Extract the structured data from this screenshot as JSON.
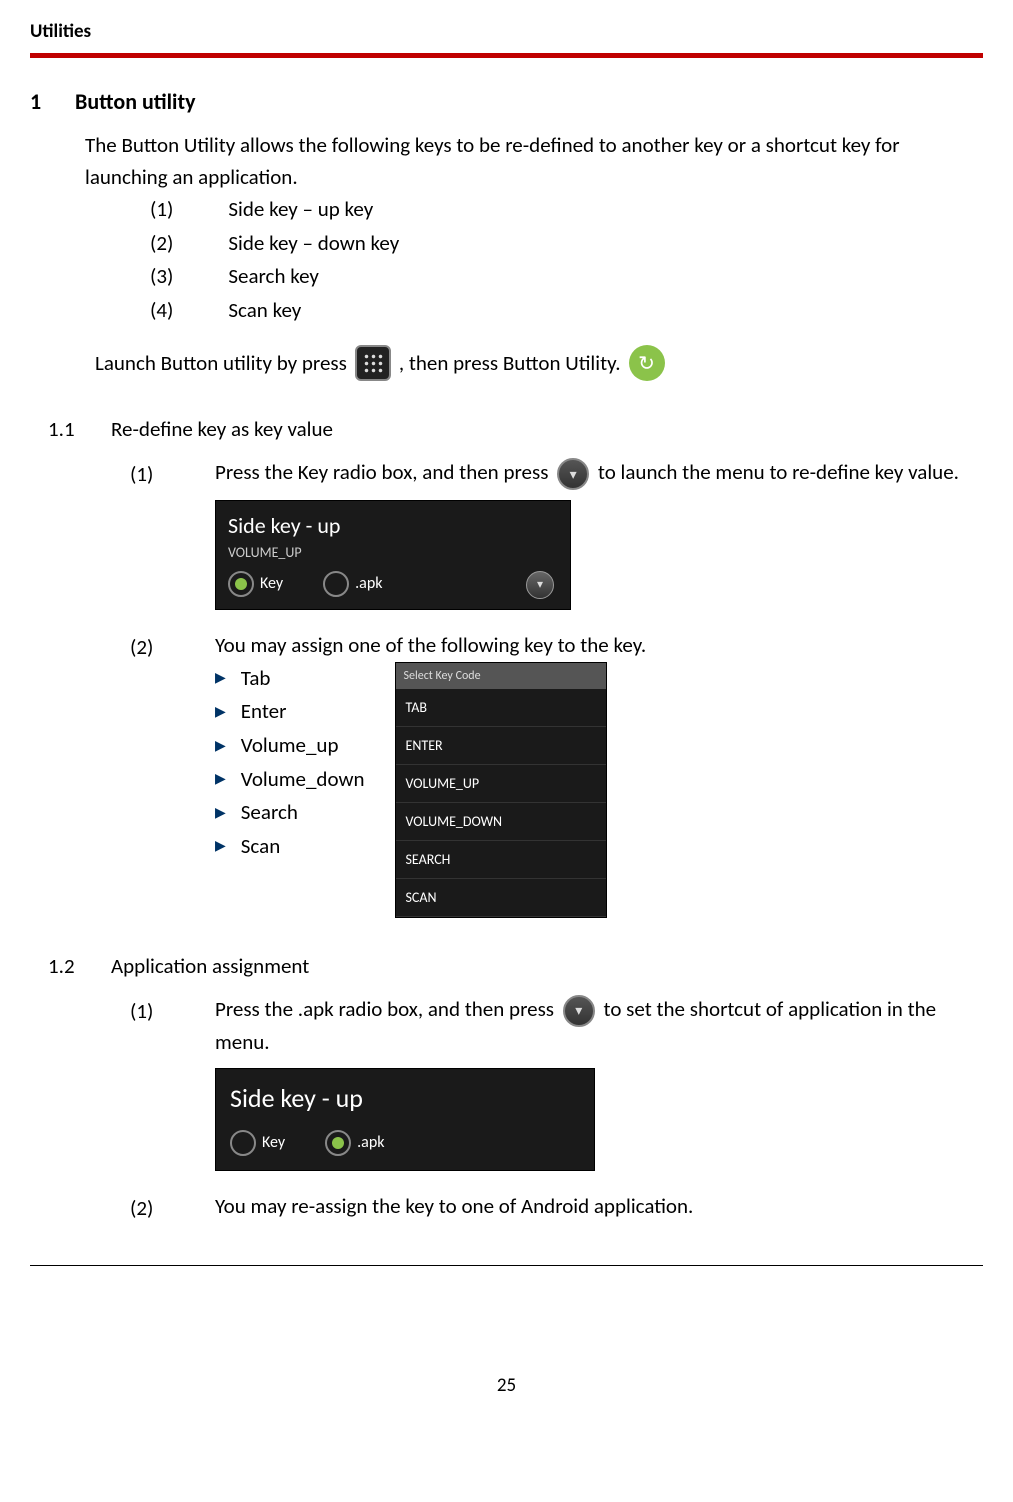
{
  "header": {
    "title": "Utilities"
  },
  "s1": {
    "num": "1",
    "title": "Button utility",
    "intro": "The Button Utility allows the following keys to be re-defined to another key or a shortcut key for launching an application.",
    "keys": [
      {
        "n": "(1)",
        "t": "Side key – up key"
      },
      {
        "n": "(2)",
        "t": "Side key – down key"
      },
      {
        "n": "(3)",
        "t": "Search key"
      },
      {
        "n": "(4)",
        "t": "Scan key"
      }
    ],
    "launch_a": "Launch Button utility by press",
    "launch_b": ", then press Button Utility."
  },
  "s11": {
    "num": "1.1",
    "title": "Re-define key as key value",
    "step1_a": "Press the Key radio box, and then press",
    "step1_b": "to launch the menu to re-define key value.",
    "shot1": {
      "title": "Side key - up",
      "sub": "VOLUME_UP",
      "r1": "Key",
      "r2": ".apk"
    },
    "step2": "You may assign one of the following key to the key.",
    "bullets": [
      "Tab",
      "Enter",
      "Volume_up",
      "Volume_down",
      "Search",
      "Scan"
    ],
    "selectHeader": "Select Key Code",
    "selectItems": [
      "TAB",
      "ENTER",
      "VOLUME_UP",
      "VOLUME_DOWN",
      "SEARCH",
      "SCAN"
    ]
  },
  "s12": {
    "num": "1.2",
    "title": "Application assignment",
    "step1_a": "Press the .apk radio box, and then press",
    "step1_b": "to set the shortcut of application in the menu.",
    "shot": {
      "title": "Side key - up",
      "r1": "Key",
      "r2": ".apk"
    },
    "step2": "You may re-assign the key to one of Android application."
  },
  "pageNum": "25"
}
